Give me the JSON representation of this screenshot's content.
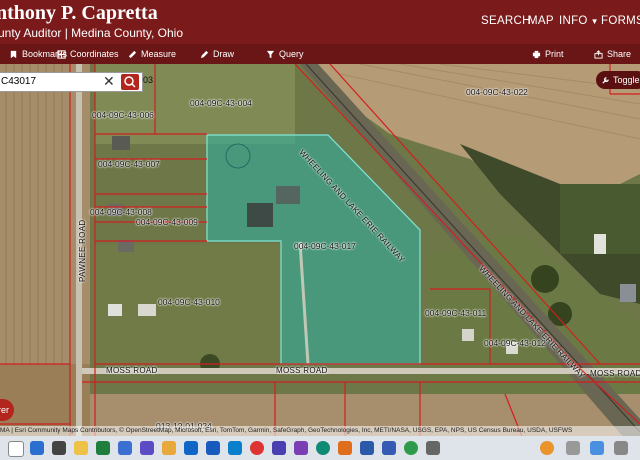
{
  "header": {
    "title": "nthony P. Capretta",
    "subtitle": "unty Auditor | Medina County, Ohio",
    "nav": {
      "search": "SEARCH",
      "map": "MAP",
      "info": "INFO",
      "forms": "FORMS"
    }
  },
  "toolbar": {
    "bookmarks": "Bookmarks",
    "coordinates": "Coordinates",
    "measure": "Measure",
    "draw": "Draw",
    "query": "Query",
    "print": "Print",
    "share": "Share"
  },
  "search": {
    "value": "C43017",
    "suffix": "03"
  },
  "toggle_label": "Toggle",
  "parcels": [
    "004-09C-43-004",
    "004-09C-43-006",
    "004-09C-43-007",
    "004-09C-43-008",
    "004-09C-43-009",
    "004-09C-43-017",
    "004-09C-43-010",
    "004-09C-43-011",
    "004-09C-43-012",
    "004-09C-43-022",
    "013-12-01-024"
  ],
  "roads": {
    "railway_1": "WHEELING AND LAKE ERIE RAILWAY",
    "railway_2": "WHEELING AND LAKE ERIE RAILWAY",
    "pawnee": "PAWNEE ROAD",
    "moss_1": "MOSS ROAD",
    "moss_2": "MOSS ROAD",
    "moss_3": "MOSS ROAD"
  },
  "attribution": "MA | Esri Community Maps Contributors, © OpenStreetMap, Microsoft, Esri, TomTom, Garmin, SafeGraph, GeoTechnologies, Inc, METI/NASA, USGS, EPA, NPS, US Census Bureau, USDA, USFWS",
  "side_button": "rer",
  "colors": {
    "header": "#7a1a1a",
    "toolbar": "#6a1616",
    "parcel_line": "#d21f1f",
    "selected_fill": "#2bb5a6"
  },
  "icons": [
    "bookmark-icon",
    "coordinates-icon",
    "ruler-icon",
    "pencil-icon",
    "query-icon",
    "print-icon",
    "share-icon",
    "search-icon",
    "close-icon",
    "wrench-icon"
  ]
}
